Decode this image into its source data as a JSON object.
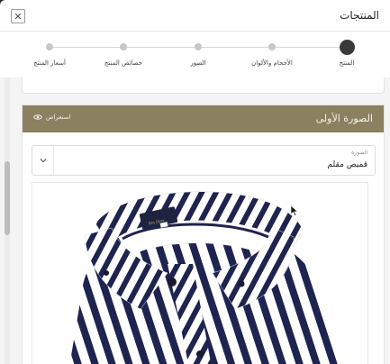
{
  "modal": {
    "title": "المنتجات",
    "close_glyph": "✕"
  },
  "stepper": {
    "steps": [
      {
        "label": "المنتج",
        "active": true
      },
      {
        "label": "الأحجام والألوان",
        "active": false
      },
      {
        "label": "الصور",
        "active": false
      },
      {
        "label": "خصائص المنتج",
        "active": false
      },
      {
        "label": "أسعار المنتج",
        "active": false
      }
    ]
  },
  "image_card": {
    "title": "الصورة الأولى",
    "preview_label": "استعراض",
    "select_caption": "الصورة",
    "select_value": "قميص مقلم",
    "header_color": "#8b8060"
  },
  "icons": {
    "close": "close-icon",
    "preview": "eye-icon",
    "dropdown": "chevron-down-icon"
  },
  "shirt_label": "Kin Dyer"
}
